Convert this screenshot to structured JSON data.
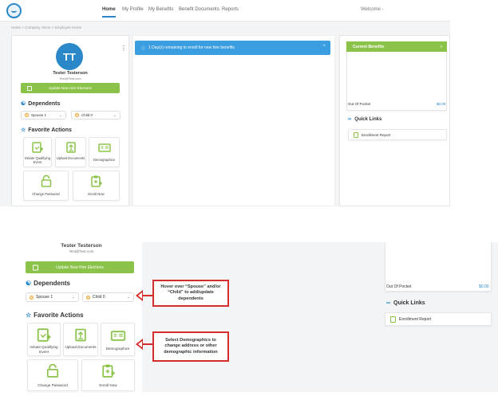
{
  "nav": {
    "items": [
      "Home",
      "My Profile",
      "My Benefits",
      "Benefit Documents",
      "Reports"
    ],
    "welcome": "Welcome -"
  },
  "breadcrumb": "Home > Company Home > Employee Home",
  "profile": {
    "initials": "TT",
    "name": "Tester Testerson",
    "email": "Test@Test.com",
    "update_button": "Update New Hire Elections"
  },
  "dependents": {
    "title": "Dependents",
    "spouse": "Spouse 1",
    "child": "Child 0"
  },
  "favorites": {
    "title": "Favorite Actions",
    "tiles": [
      "Initiate Qualifying Event",
      "Upload Documents",
      "Demographics",
      "Change Password",
      "Enroll Now"
    ]
  },
  "notice": "1 Day(s) remaining to enroll for new hire benefits",
  "current_benefits": {
    "title": "Current Benefits",
    "oop_label": "Out Of Pocket",
    "oop_value": "$0.00"
  },
  "quick_links": {
    "title": "Quick Links",
    "items": [
      "Enrollment Report"
    ]
  },
  "callouts": {
    "dependents": "Hover over “Spouse” and/or “Child” to add/update dependents",
    "demographics": "Select Demographics to change address or other demographic information"
  },
  "colors": {
    "primary": "#2a88c8",
    "accent_green": "#8bc34a",
    "info_blue": "#3a9ee0",
    "callout_red": "#d62c2c"
  }
}
